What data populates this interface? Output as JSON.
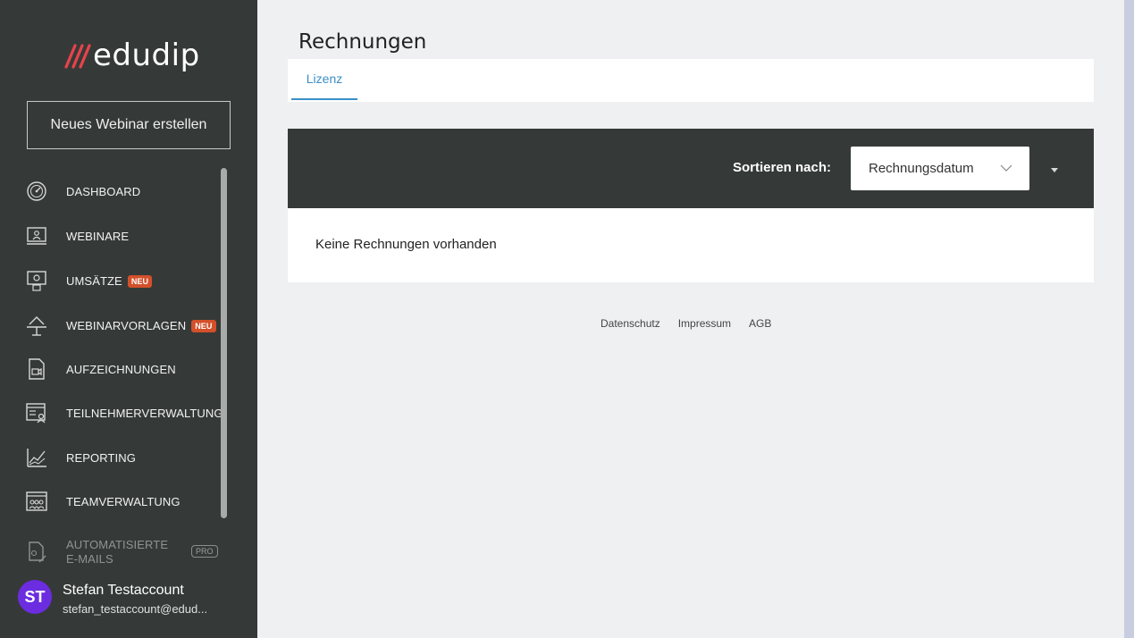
{
  "brand": {
    "logo_text": "edudip",
    "accent_colors": [
      "#e8434a",
      "#d3502a"
    ]
  },
  "sidebar": {
    "new_webinar_label": "Neues Webinar erstellen",
    "items": [
      {
        "label": "DASHBOARD",
        "icon": "speedometer-icon"
      },
      {
        "label": "WEBINARE",
        "icon": "presentation-screen-icon"
      },
      {
        "label": "UMSÄTZE",
        "icon": "money-monitor-icon",
        "badge": "NEU"
      },
      {
        "label": "WEBINARVORLAGEN",
        "icon": "template-desk-icon",
        "badge": "NEU"
      },
      {
        "label": "AUFZEICHNUNGEN",
        "icon": "recording-file-icon"
      },
      {
        "label": "TEILNEHMERVERWALTUNG",
        "icon": "participant-list-icon"
      },
      {
        "label": "REPORTING",
        "icon": "chart-line-icon"
      },
      {
        "label": "TEAMVERWALTUNG",
        "icon": "team-icon"
      },
      {
        "label": "AUTOMATISIERTE E-MAILS",
        "icon": "automated-mail-icon",
        "badge": "PRO"
      }
    ]
  },
  "user": {
    "initials": "ST",
    "name": "Stefan Testaccount",
    "email": "stefan_testaccount@edud...",
    "avatar_color": "#6c2ce0"
  },
  "main": {
    "title": "Rechnungen",
    "tabs": [
      {
        "label": "Lizenz",
        "active": true
      }
    ],
    "sort": {
      "label": "Sortieren nach:",
      "selected": "Rechnungsdatum"
    },
    "empty_text": "Keine Rechnungen vorhanden"
  },
  "footer": {
    "links": [
      "Datenschutz",
      "Impressum",
      "AGB"
    ]
  }
}
